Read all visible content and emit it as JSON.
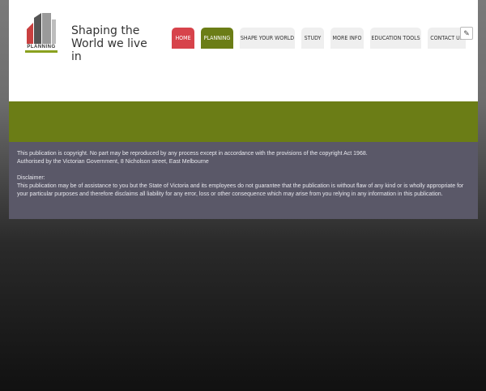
{
  "brand": {
    "logo_text": "PLANNING",
    "tagline_line1": "Shaping the",
    "tagline_line2": "World we live in"
  },
  "nav": {
    "items": [
      {
        "label": "HOME"
      },
      {
        "label": "PLANNING"
      },
      {
        "label": "SHAPE YOUR WORLD"
      },
      {
        "label": "STUDY"
      },
      {
        "label": "MORE INFO"
      },
      {
        "label": "EDUCATION TOOLS"
      },
      {
        "label": "CONTACT US"
      }
    ]
  },
  "edit_icon": "pencil-icon",
  "footer": {
    "copyright_line1": "This publication is copyright. No part may be reproduced by any process except in accordance with the provisions of the copyright Act 1968.",
    "copyright_line2": "Authorised by the Victorian Government, 8 Nicholson street, East Melbourne",
    "disclaimer_title": "Disclaimer:",
    "disclaimer_text": "This publication may be of assistance to you but the State of Victoria and its employees do not guarantee that the publication is without flaw of any kind or is wholly appropriate for your particular purposes and therefore disclaims all liability for any error, loss or other consequence which may arise from you relying in any information in this publication."
  },
  "colors": {
    "home_tab": "#d7434b",
    "planning_tab": "#6b7d16",
    "footer_bg": "#5a5868"
  }
}
